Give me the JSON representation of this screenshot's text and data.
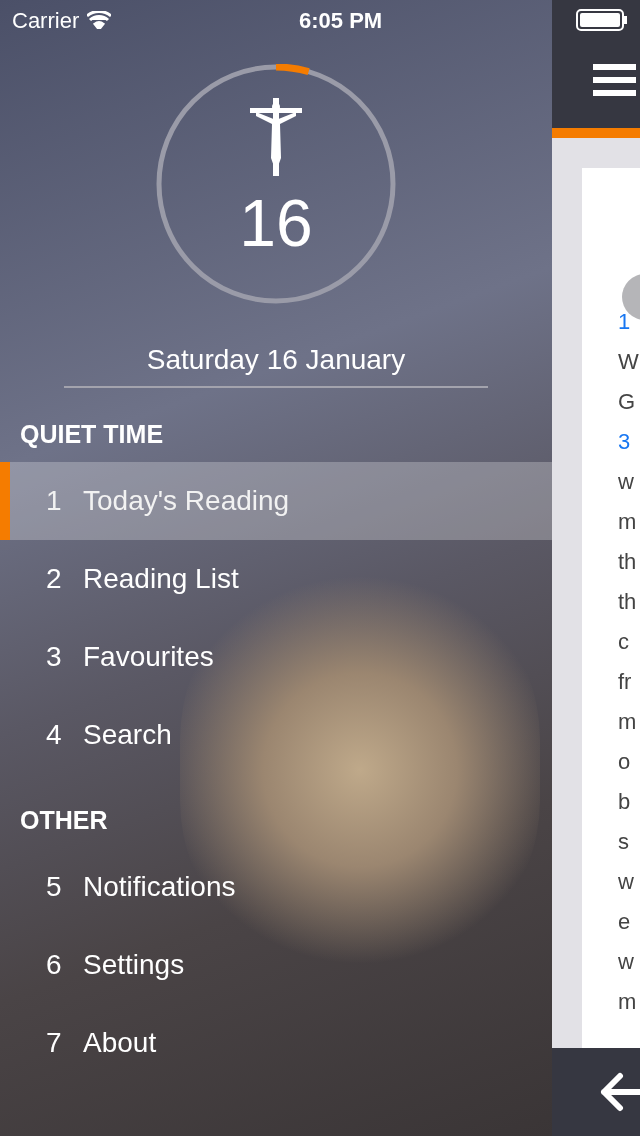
{
  "status_bar": {
    "carrier": "Carrier",
    "time": "6:05 PM"
  },
  "header": {
    "day_number": "16",
    "progress": {
      "level": 0.045
    },
    "date": "Saturday 16 January"
  },
  "sections": [
    {
      "title": "QUIET TIME",
      "items": [
        {
          "number": "1",
          "label": "Today's Reading",
          "selected": true
        },
        {
          "number": "2",
          "label": "Reading List",
          "selected": false
        },
        {
          "number": "3",
          "label": "Favourites",
          "selected": false
        },
        {
          "number": "4",
          "label": "Search",
          "selected": false
        }
      ]
    },
    {
      "title": "OTHER",
      "items": [
        {
          "number": "5",
          "label": "Notifications",
          "selected": false
        },
        {
          "number": "6",
          "label": "Settings",
          "selected": false
        },
        {
          "number": "7",
          "label": "About",
          "selected": false
        }
      ]
    }
  ],
  "reading_lines": [
    {
      "kind": "verse",
      "text": "1"
    },
    {
      "kind": "text",
      "text": "W"
    },
    {
      "kind": "text",
      "text": "G"
    },
    {
      "kind": "verse",
      "text": "3"
    },
    {
      "kind": "text",
      "text": "w"
    },
    {
      "kind": "text",
      "text": "m"
    },
    {
      "kind": "text",
      "text": "th"
    },
    {
      "kind": "text",
      "text": "th"
    },
    {
      "kind": "text",
      "text": "c"
    },
    {
      "kind": "text",
      "text": "fr"
    },
    {
      "kind": "text",
      "text": "m"
    },
    {
      "kind": "text",
      "text": "o"
    },
    {
      "kind": "text",
      "text": "b"
    },
    {
      "kind": "text",
      "text": "s"
    },
    {
      "kind": "text",
      "text": "w"
    },
    {
      "kind": "text",
      "text": "e"
    },
    {
      "kind": "text",
      "text": "w"
    },
    {
      "kind": "text",
      "text": "m"
    }
  ]
}
